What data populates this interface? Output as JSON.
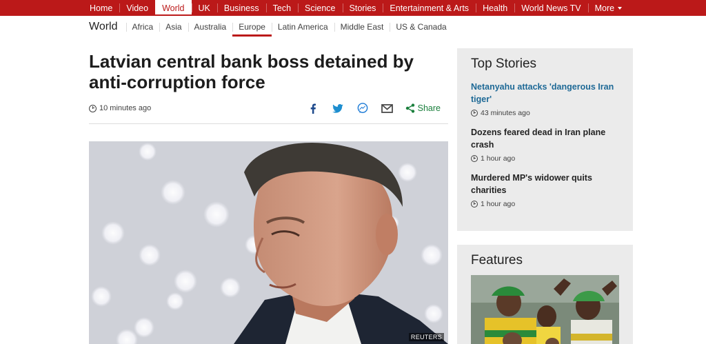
{
  "topnav": {
    "items": [
      "Home",
      "Video",
      "World",
      "UK",
      "Business",
      "Tech",
      "Science",
      "Stories",
      "Entertainment & Arts",
      "Health",
      "World News TV",
      "More"
    ],
    "active_index": 2
  },
  "subnav": {
    "section": "World",
    "items": [
      "Africa",
      "Asia",
      "Australia",
      "Europe",
      "Latin America",
      "Middle East",
      "US & Canada"
    ],
    "active_index": 3
  },
  "article": {
    "headline": "Latvian central bank boss detained by anti-corruption force",
    "timestamp": "10 minutes ago",
    "share_label": "Share",
    "share_icons": [
      "facebook-icon",
      "twitter-icon",
      "messenger-icon",
      "email-icon",
      "share-icon"
    ],
    "image_credit": "REUTERS"
  },
  "sidebar": {
    "top_stories_title": "Top Stories",
    "top_stories": [
      {
        "title": "Netanyahu attacks 'dangerous Iran tiger'",
        "time": "43 minutes ago"
      },
      {
        "title": "Dozens feared dead in Iran plane crash",
        "time": "1 hour ago"
      },
      {
        "title": "Murdered MP's widower quits charities",
        "time": "1 hour ago"
      }
    ],
    "features_title": "Features"
  },
  "colors": {
    "brand": "#bb1919",
    "link": "#1e6996",
    "share_green": "#1a7f3c",
    "panel_bg": "#ebebeb"
  }
}
